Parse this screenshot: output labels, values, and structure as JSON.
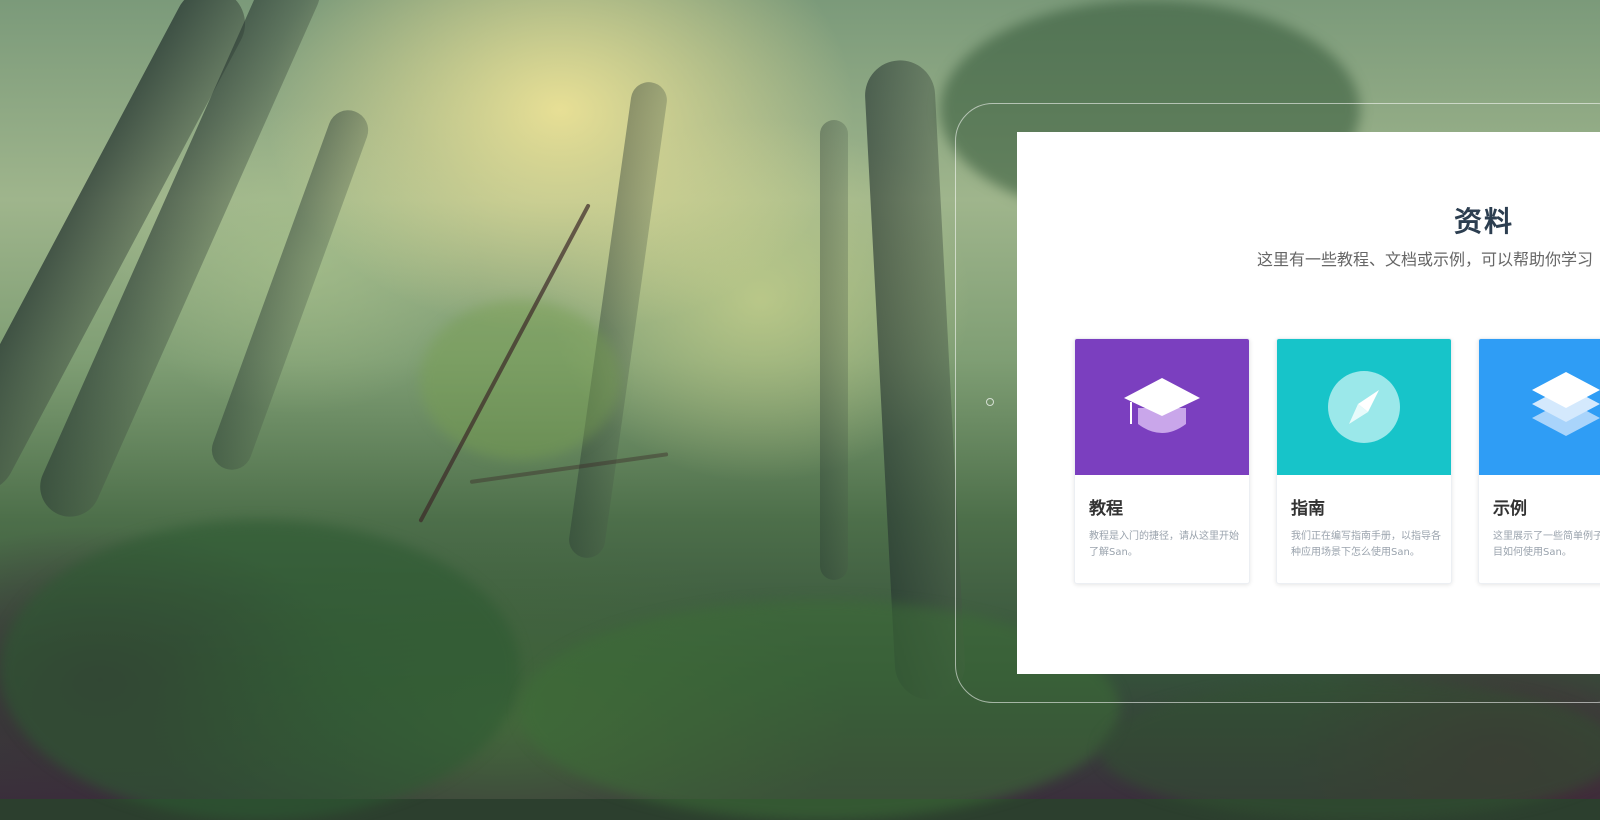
{
  "panel": {
    "title": "资料",
    "subtitle": "这里有一些教程、文档或示例，可以帮助你学习"
  },
  "cards": [
    {
      "label": "教程",
      "description": "教程是入门的捷径，请从这里开始了解San。",
      "color": "#7b3fbf",
      "icon": "graduation-cap-icon"
    },
    {
      "label": "指南",
      "description": "我们正在编写指南手册，以指导各种应用场景下怎么使用San。",
      "color": "#17c4c9",
      "icon": "compass-icon"
    },
    {
      "label": "示例",
      "description": "这里展示了一些简单例子，实际项目如何使用San。",
      "color": "#2f9df5",
      "icon": "layers-icon"
    }
  ]
}
